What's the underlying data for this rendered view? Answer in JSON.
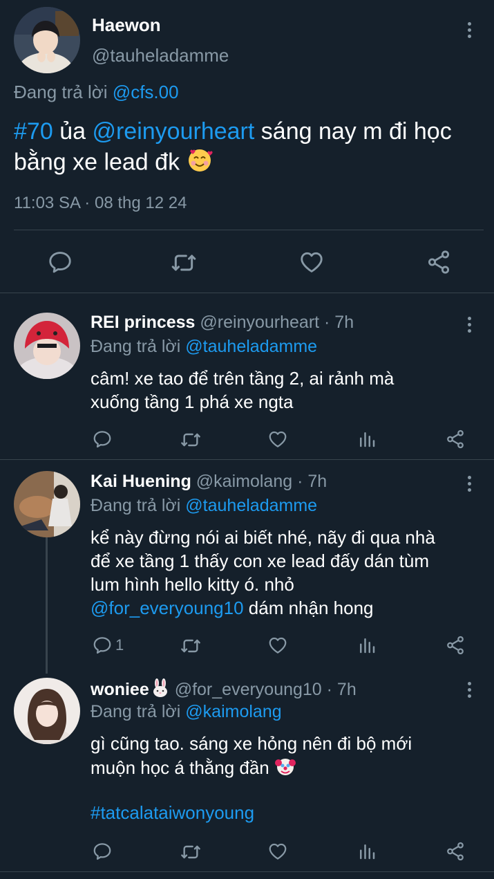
{
  "main_tweet": {
    "display_name": "Haewon",
    "handle": "@tauheladamme",
    "replying_prefix": "Đang trả lời",
    "replying_to": "@cfs.00",
    "text_hashtag": "#70",
    "text_part1": "ủa",
    "text_mention": "@reinyourheart",
    "text_part2": "sáng nay m đi học",
    "text_line2": "bằng xe lead đk",
    "emoji": "smiling-face-with-hearts",
    "timestamp": "11:03 SA · 08 thg 12 24"
  },
  "replies": [
    {
      "display_name": "REI princess",
      "handle_time": "@reinyourheart · 7h",
      "replying_prefix": "Đang trả lời",
      "replying_to": "@tauheladamme",
      "line1": "câm! xe tao để trên tầng 2, ai rảnh mà",
      "line2": "xuống tầng 1 phá xe ngta"
    },
    {
      "display_name": "Kai Huening",
      "handle_time": "@kaimolang · 7h",
      "replying_prefix": "Đang trả lời",
      "replying_to": "@tauheladamme",
      "line1": "kể này đừng nói ai biết nhé, nãy đi qua nhà",
      "line2": "để xe tầng 1 thấy con xe lead đấy dán tùm",
      "line3": "lum hình hello kitty ó. nhỏ",
      "mention": "@for_everyoung10",
      "line4_rest": "dám nhận hong",
      "reply_count": "1"
    },
    {
      "display_name": "woniee",
      "name_emoji": "rabbit-face",
      "handle_time": "@for_everyoung10 · 7h",
      "replying_prefix": "Đang trả lời",
      "replying_to": "@kaimolang",
      "line1": "gì cũng tao. sáng xe hỏng nên đi bộ mới",
      "line2": "muộn học á thằng đần",
      "line2_emoji": "clown-face",
      "hashtag": "#tatcalataiwonyoung"
    }
  ],
  "colors": {
    "background": "#15202b",
    "text": "#ffffff",
    "muted": "#8899a6",
    "link": "#1d9bf0",
    "divider": "#38444d"
  },
  "icons": [
    "reply-icon",
    "retweet-icon",
    "like-icon",
    "analytics-icon",
    "share-icon",
    "more-icon"
  ]
}
